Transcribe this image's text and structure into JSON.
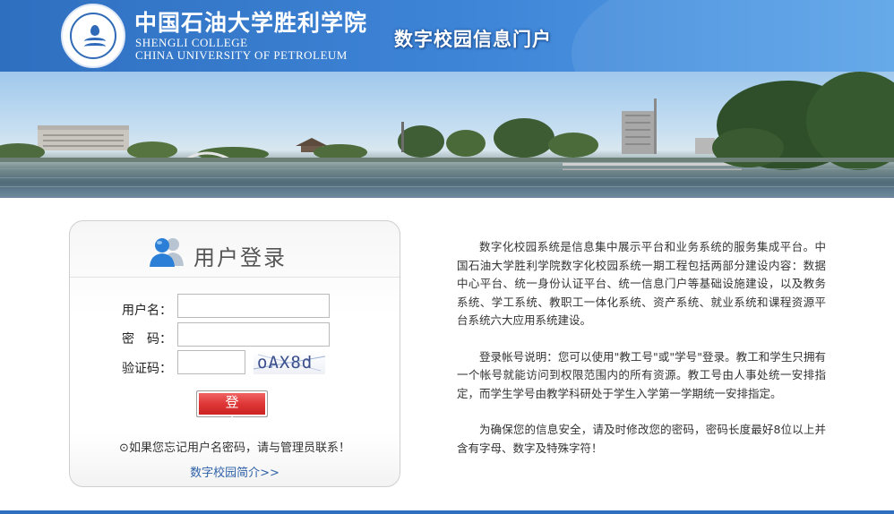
{
  "header": {
    "school_name_cn": "中国石油大学胜利学院",
    "school_name_en_line1": "SHENGLI COLLEGE",
    "school_name_en_line2": "CHINA UNIVERSITY OF PETROLEUM",
    "portal_title": "数字校园信息门户"
  },
  "login": {
    "title": "用户登录",
    "username_label": "用户名：",
    "password_label": "密　码：",
    "captcha_label": "验证码：",
    "username_value": "",
    "password_value": "",
    "captcha_value": "",
    "captcha_text": "oAX8d",
    "submit_label": "登 录",
    "forgot_text": "⊙如果您忘记用户名密码，请与管理员联系！",
    "intro_link": "数字校园简介>>"
  },
  "description": {
    "paragraphs": [
      "数字化校园系统是信息集中展示平台和业务系统的服务集成平台。中国石油大学胜利学院数字化校园系统一期工程包括两部分建设内容：数据中心平台、统一身份认证平台、统一信息门户等基础设施建设，以及教务系统、学工系统、教职工一体化系统、资产系统、就业系统和课程资源平台系统六大应用系统建设。",
      "登录帐号说明：您可以使用\"教工号\"或\"学号\"登录。教工和学生只拥有一个帐号就能访问到权限范围内的所有资源。教工号由人事处统一安排指定，而学生学号由教学科研处于学生入学第一学期统一安排指定。",
      "为确保您的信息安全，请及时修改您的密码，密码长度最好8位以上并含有字母、数字及特殊字符！"
    ]
  },
  "colors": {
    "header_blue": "#2f6fc0",
    "login_red": "#df3737",
    "link_blue": "#2f62a8"
  },
  "icons": {
    "logo": "school-seal-icon",
    "user": "user-group-icon"
  }
}
